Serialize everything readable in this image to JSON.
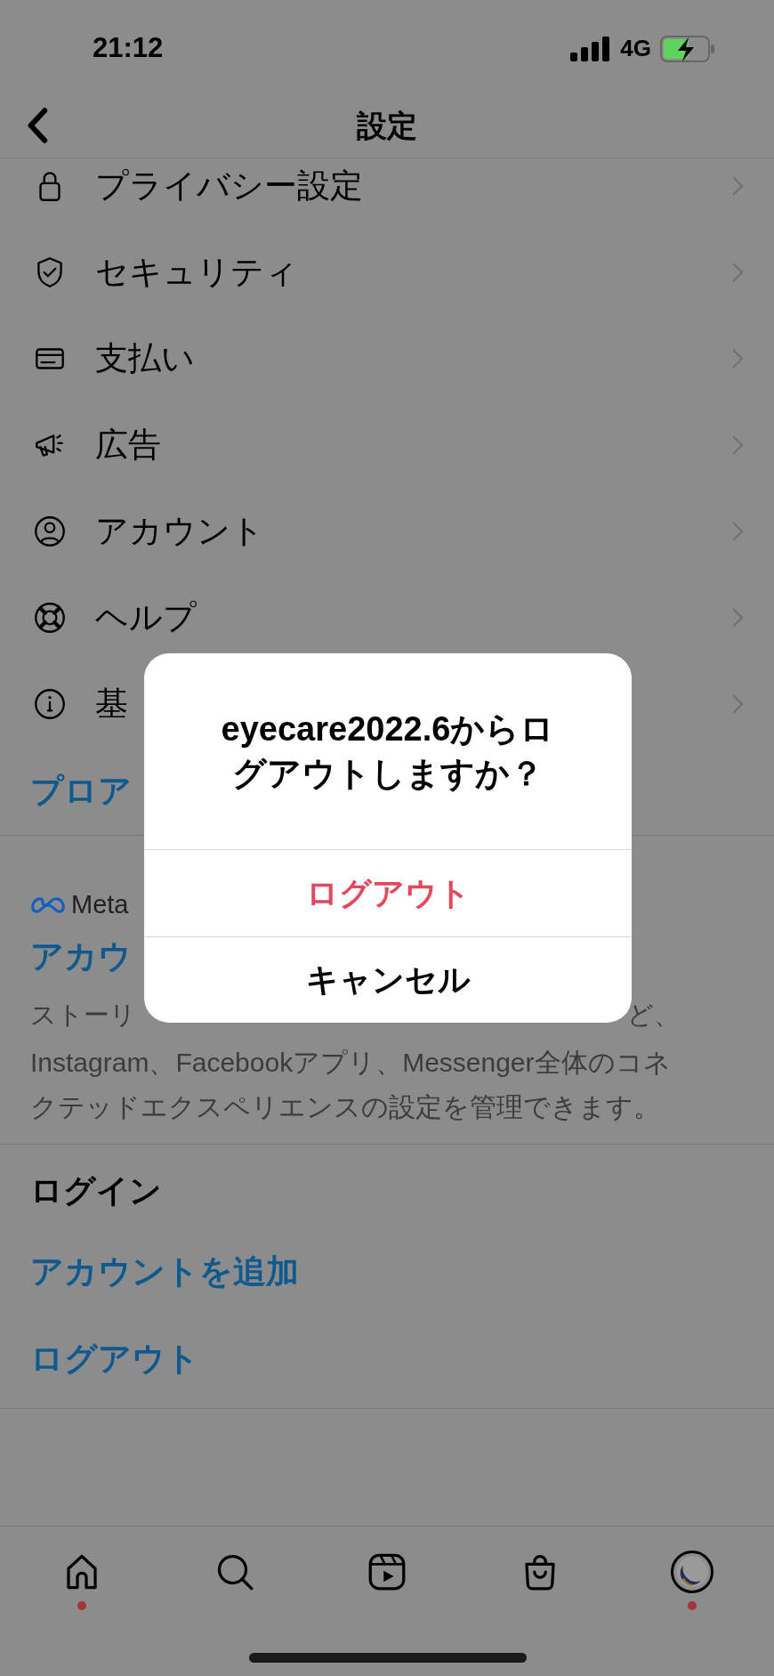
{
  "status_bar": {
    "time": "21:12",
    "network": "4G"
  },
  "header": {
    "title": "設定"
  },
  "menu": [
    {
      "label": "プライバシー設定"
    },
    {
      "label": "セキュリティ"
    },
    {
      "label": "支払い"
    },
    {
      "label": "広告"
    },
    {
      "label": "アカウント"
    },
    {
      "label": "ヘルプ"
    },
    {
      "label": "基"
    }
  ],
  "pro_link": "プロア",
  "meta_section": {
    "brand": "Meta",
    "link": "アカウ",
    "description_start": "ストーリ",
    "description_end": "ど、",
    "description": "Instagram、Facebookアプリ、Messenger全体のコネクテッドエクスペリエンスの設定を管理できます。"
  },
  "login": {
    "heading": "ログイン",
    "links": [
      "アカウントを追加",
      "ログアウト"
    ]
  },
  "dialog": {
    "message": "eyecare2022.6からログアウトしますか？",
    "buttons": [
      {
        "label": "ログアウト",
        "kind": "destructive"
      },
      {
        "label": "キャンセル",
        "kind": "default"
      }
    ]
  },
  "tab_bar": [
    {
      "badge": true
    },
    {
      "badge": false
    },
    {
      "badge": false
    },
    {
      "badge": false
    },
    {
      "badge": true
    }
  ]
}
